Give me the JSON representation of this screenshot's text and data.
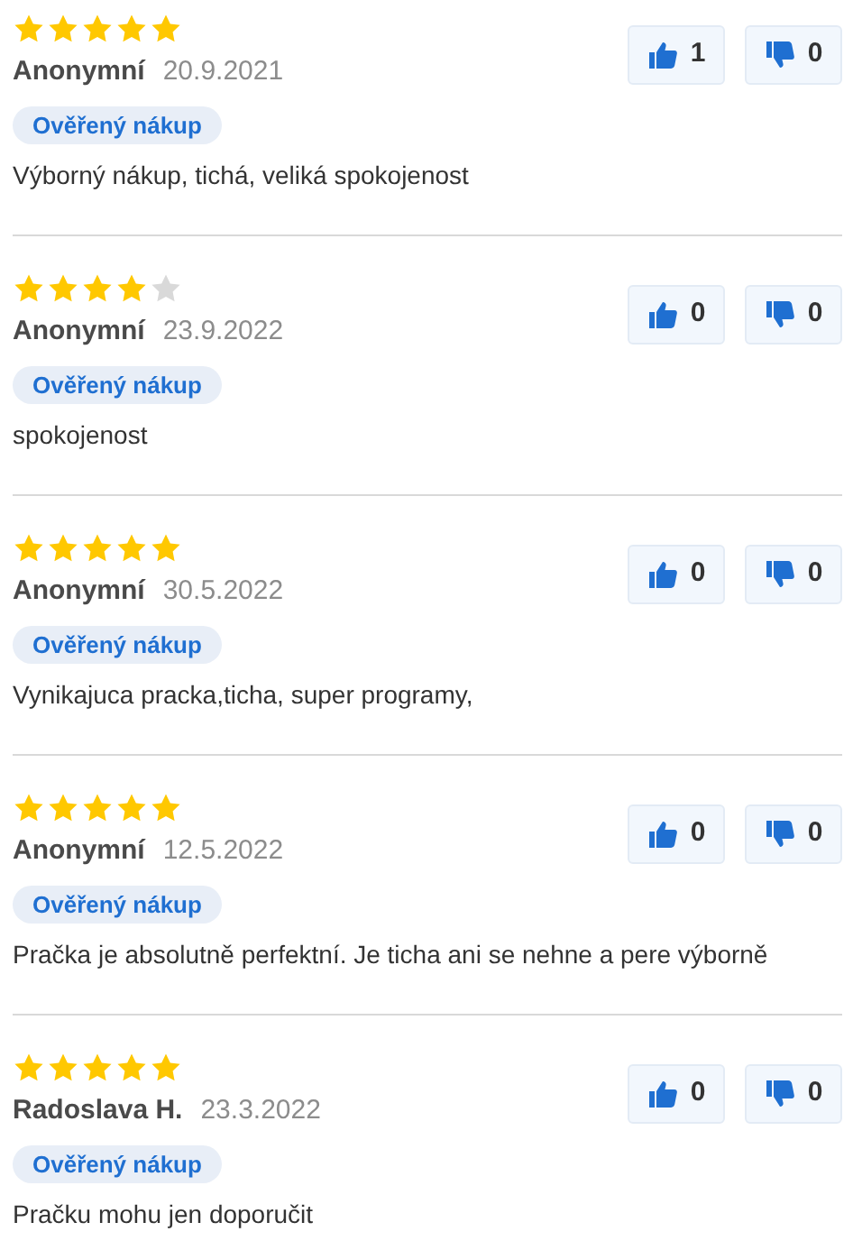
{
  "reviews": [
    {
      "stars": 5,
      "author": "Anonymní",
      "date": "20.9.2021",
      "badge": "Ověřený nákup",
      "text": "Výborný nákup, tichá, veliká spokojenost",
      "likes": "1",
      "dislikes": "0"
    },
    {
      "stars": 4,
      "author": "Anonymní",
      "date": "23.9.2022",
      "badge": "Ověřený nákup",
      "text": "spokojenost",
      "likes": "0",
      "dislikes": "0"
    },
    {
      "stars": 5,
      "author": "Anonymní",
      "date": "30.5.2022",
      "badge": "Ověřený nákup",
      "text": "Vynikajuca pracka,ticha, super programy,",
      "likes": "0",
      "dislikes": "0"
    },
    {
      "stars": 5,
      "author": "Anonymní",
      "date": "12.5.2022",
      "badge": "Ověřený nákup",
      "text": "Pračka je absolutně perfektní. Je ticha ani se nehne a pere výborně",
      "likes": "0",
      "dislikes": "0"
    },
    {
      "stars": 5,
      "author": "Radoslava H.",
      "date": "23.3.2022",
      "badge": "Ověřený nákup",
      "text": "Pračku mohu jen doporučit",
      "likes": "0",
      "dislikes": "0"
    }
  ]
}
